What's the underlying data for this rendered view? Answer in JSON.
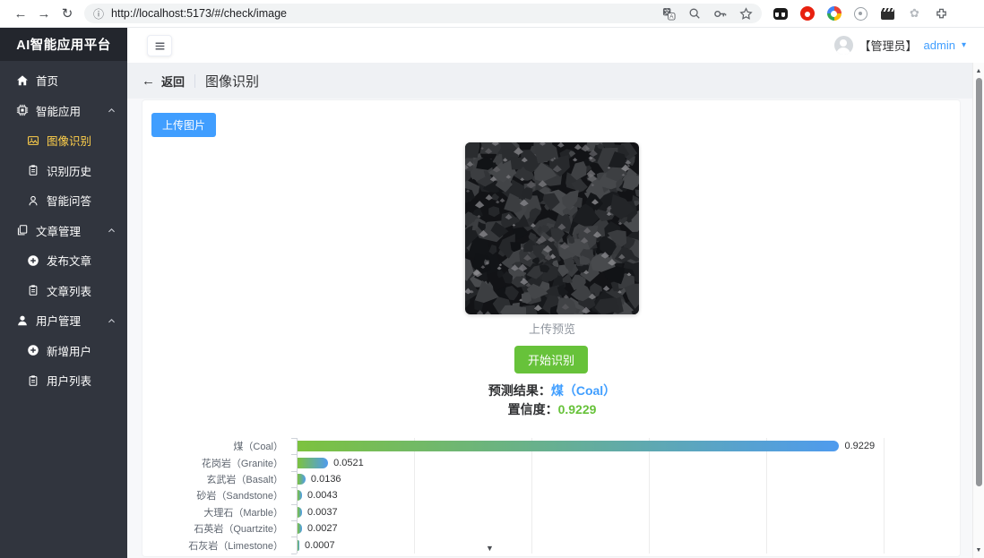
{
  "browser": {
    "url": "http://localhost:5173/#/check/image",
    "toolbar_icons": [
      "back-arrow",
      "forward-arrow",
      "refresh",
      "site-info",
      "translate",
      "zoom-search",
      "passwords-key",
      "bookmark-star",
      "extension-glasses",
      "extension-red-circle",
      "extension-color-wheel",
      "extension-gray-circle",
      "extension-clapperboard",
      "extension-flower",
      "extensions-puzzle",
      "profile-avatar",
      "menu-dots"
    ]
  },
  "sidebar": {
    "title": "AI智能应用平台",
    "items": [
      {
        "key": "home",
        "label": "首页",
        "icon": "home",
        "level": 1,
        "caret": false,
        "active": false
      },
      {
        "key": "smart-apps",
        "label": "智能应用",
        "icon": "chip",
        "level": 1,
        "caret": true,
        "active": false
      },
      {
        "key": "image-recognition",
        "label": "图像识别",
        "icon": "picture",
        "level": 2,
        "caret": false,
        "active": true
      },
      {
        "key": "recognition-history",
        "label": "识别历史",
        "icon": "clipboard",
        "level": 2,
        "caret": false,
        "active": false
      },
      {
        "key": "smart-qa",
        "label": "智能问答",
        "icon": "person",
        "level": 2,
        "caret": false,
        "active": false
      },
      {
        "key": "article-management",
        "label": "文章管理",
        "icon": "documents",
        "level": 1,
        "caret": true,
        "active": false
      },
      {
        "key": "publish-article",
        "label": "发布文章",
        "icon": "plus-circle",
        "level": 2,
        "caret": false,
        "active": false
      },
      {
        "key": "article-list",
        "label": "文章列表",
        "icon": "clipboard",
        "level": 2,
        "caret": false,
        "active": false
      },
      {
        "key": "user-management",
        "label": "用户管理",
        "icon": "user-solid",
        "level": 1,
        "caret": true,
        "active": false
      },
      {
        "key": "add-user",
        "label": "新增用户",
        "icon": "plus-circle",
        "level": 2,
        "caret": false,
        "active": false
      },
      {
        "key": "user-list",
        "label": "用户列表",
        "icon": "clipboard",
        "level": 2,
        "caret": false,
        "active": false
      }
    ]
  },
  "topbar": {
    "role": "【管理员】",
    "username": "admin"
  },
  "page_header": {
    "back_label": "返回",
    "title": "图像识别"
  },
  "main": {
    "upload_button": "上传图片",
    "preview_caption": "上传预览",
    "recognize_button": "开始识别",
    "result_label": "预测结果：",
    "result_value": "煤（Coal）",
    "confidence_label": "置信度：",
    "confidence_value": "0.9229"
  },
  "chart_data": {
    "type": "bar",
    "orientation": "horizontal",
    "categories": [
      "煤（Coal）",
      "花岗岩（Granite）",
      "玄武岩（Basalt）",
      "砂岩（Sandstone）",
      "大理石（Marble）",
      "石英岩（Quartzite）",
      "石灰岩（Limestone）"
    ],
    "values": [
      0.9229,
      0.0521,
      0.0136,
      0.0043,
      0.0037,
      0.0027,
      0.0007
    ],
    "value_labels": [
      "0.9229",
      "0.0521",
      "0.0136",
      "0.0043",
      "0.0037",
      "0.0027",
      "0.0007"
    ],
    "xlim": [
      0,
      1.0
    ],
    "gridline_step": 0.2,
    "grid": true,
    "legend": "none",
    "title": "",
    "xlabel": "",
    "ylabel": "",
    "bar_gradient": [
      "#7cc23f",
      "#4f9bee"
    ]
  },
  "colors": {
    "accent_blue": "#409eff",
    "success_green": "#67c23a",
    "sidebar_bg": "#31353e",
    "sidebar_logo_bg": "#23262d",
    "sidebar_active": "#ffd04b",
    "header_band": "#eff1f4"
  }
}
